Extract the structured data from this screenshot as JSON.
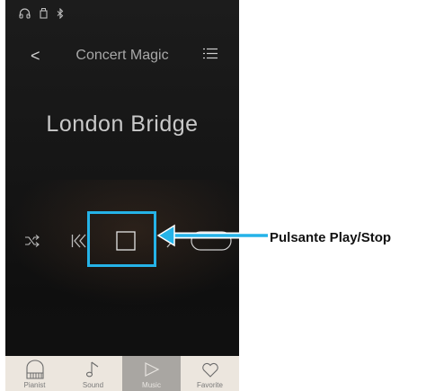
{
  "header": {
    "title": "Concert Magic",
    "back_glyph": "<"
  },
  "song": {
    "title": "London Bridge"
  },
  "status_icons": [
    "headphones-icon",
    "usb-icon",
    "bluetooth-icon"
  ],
  "controls": [
    "shuffle-icon",
    "previous-icon",
    "stop-icon",
    "next-icon",
    "toggle-switch"
  ],
  "tabs": [
    {
      "label": "Pianist",
      "icon": "piano-icon"
    },
    {
      "label": "Sound",
      "icon": "music-note-icon"
    },
    {
      "label": "Music",
      "icon": "play-icon",
      "active": true
    },
    {
      "label": "Favorite",
      "icon": "heart-icon"
    }
  ],
  "annotation": {
    "label": "Pulsante Play/Stop"
  },
  "colors": {
    "highlight": "#25b3e8",
    "tabbar": "#ece6de",
    "active_tab": "#a9a6a2"
  }
}
